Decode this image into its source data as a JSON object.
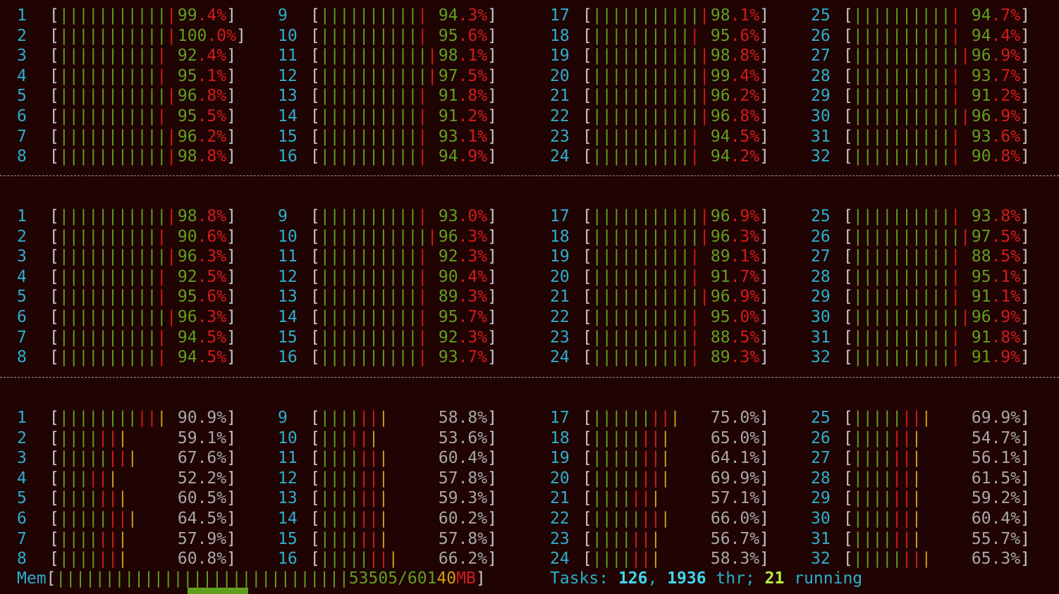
{
  "colors": {
    "background": "#200303",
    "low": "#5fa01e",
    "high": "#d21b1b",
    "mid": "#c9a116",
    "label": "#2bb0cc"
  },
  "blocks": [
    {
      "cpus": [
        {
          "n": "1",
          "v": "99.4%"
        },
        {
          "n": "2",
          "v": "100.0%"
        },
        {
          "n": "3",
          "v": "92.4%"
        },
        {
          "n": "4",
          "v": "95.1%"
        },
        {
          "n": "5",
          "v": "96.8%"
        },
        {
          "n": "6",
          "v": "95.5%"
        },
        {
          "n": "7",
          "v": "96.2%"
        },
        {
          "n": "8",
          "v": "98.8%"
        },
        {
          "n": "9",
          "v": "94.3%"
        },
        {
          "n": "10",
          "v": "95.6%"
        },
        {
          "n": "11",
          "v": "98.1%"
        },
        {
          "n": "12",
          "v": "97.5%"
        },
        {
          "n": "13",
          "v": "91.8%"
        },
        {
          "n": "14",
          "v": "91.2%"
        },
        {
          "n": "15",
          "v": "93.1%"
        },
        {
          "n": "16",
          "v": "94.9%"
        },
        {
          "n": "17",
          "v": "98.1%"
        },
        {
          "n": "18",
          "v": "95.6%"
        },
        {
          "n": "19",
          "v": "98.8%"
        },
        {
          "n": "20",
          "v": "99.4%"
        },
        {
          "n": "21",
          "v": "96.2%"
        },
        {
          "n": "22",
          "v": "96.8%"
        },
        {
          "n": "23",
          "v": "94.5%"
        },
        {
          "n": "24",
          "v": "94.2%"
        },
        {
          "n": "25",
          "v": "94.7%"
        },
        {
          "n": "26",
          "v": "94.4%"
        },
        {
          "n": "27",
          "v": "96.9%"
        },
        {
          "n": "28",
          "v": "93.7%"
        },
        {
          "n": "29",
          "v": "91.2%"
        },
        {
          "n": "30",
          "v": "96.9%"
        },
        {
          "n": "31",
          "v": "93.6%"
        },
        {
          "n": "32",
          "v": "90.8%"
        }
      ]
    },
    {
      "cpus": [
        {
          "n": "1",
          "v": "98.8%"
        },
        {
          "n": "2",
          "v": "90.6%"
        },
        {
          "n": "3",
          "v": "96.3%"
        },
        {
          "n": "4",
          "v": "92.5%"
        },
        {
          "n": "5",
          "v": "95.6%"
        },
        {
          "n": "6",
          "v": "96.3%"
        },
        {
          "n": "7",
          "v": "94.5%"
        },
        {
          "n": "8",
          "v": "94.5%"
        },
        {
          "n": "9",
          "v": "93.0%"
        },
        {
          "n": "10",
          "v": "96.3%"
        },
        {
          "n": "11",
          "v": "92.3%"
        },
        {
          "n": "12",
          "v": "90.4%"
        },
        {
          "n": "13",
          "v": "89.3%"
        },
        {
          "n": "14",
          "v": "95.7%"
        },
        {
          "n": "15",
          "v": "92.3%"
        },
        {
          "n": "16",
          "v": "93.7%"
        },
        {
          "n": "17",
          "v": "96.9%"
        },
        {
          "n": "18",
          "v": "96.3%"
        },
        {
          "n": "19",
          "v": "89.1%"
        },
        {
          "n": "20",
          "v": "91.7%"
        },
        {
          "n": "21",
          "v": "96.9%"
        },
        {
          "n": "22",
          "v": "95.0%"
        },
        {
          "n": "23",
          "v": "88.5%"
        },
        {
          "n": "24",
          "v": "89.3%"
        },
        {
          "n": "25",
          "v": "93.8%"
        },
        {
          "n": "26",
          "v": "97.5%"
        },
        {
          "n": "27",
          "v": "88.5%"
        },
        {
          "n": "28",
          "v": "95.1%"
        },
        {
          "n": "29",
          "v": "91.1%"
        },
        {
          "n": "30",
          "v": "96.9%"
        },
        {
          "n": "31",
          "v": "91.8%"
        },
        {
          "n": "32",
          "v": "91.9%"
        }
      ]
    },
    {
      "cpus": [
        {
          "n": "1",
          "v": "90.9%"
        },
        {
          "n": "2",
          "v": "59.1%"
        },
        {
          "n": "3",
          "v": "67.6%"
        },
        {
          "n": "4",
          "v": "52.2%"
        },
        {
          "n": "5",
          "v": "60.5%"
        },
        {
          "n": "6",
          "v": "64.5%"
        },
        {
          "n": "7",
          "v": "57.9%"
        },
        {
          "n": "8",
          "v": "60.8%"
        },
        {
          "n": "9",
          "v": "58.8%"
        },
        {
          "n": "10",
          "v": "53.6%"
        },
        {
          "n": "11",
          "v": "60.4%"
        },
        {
          "n": "12",
          "v": "57.8%"
        },
        {
          "n": "13",
          "v": "59.3%"
        },
        {
          "n": "14",
          "v": "60.2%"
        },
        {
          "n": "15",
          "v": "57.8%"
        },
        {
          "n": "16",
          "v": "66.2%"
        },
        {
          "n": "17",
          "v": "75.0%"
        },
        {
          "n": "18",
          "v": "65.0%"
        },
        {
          "n": "19",
          "v": "64.1%"
        },
        {
          "n": "20",
          "v": "69.9%"
        },
        {
          "n": "21",
          "v": "57.1%"
        },
        {
          "n": "22",
          "v": "66.0%"
        },
        {
          "n": "23",
          "v": "56.7%"
        },
        {
          "n": "24",
          "v": "58.3%"
        },
        {
          "n": "25",
          "v": "69.9%"
        },
        {
          "n": "26",
          "v": "54.7%"
        },
        {
          "n": "27",
          "v": "56.1%"
        },
        {
          "n": "28",
          "v": "61.5%"
        },
        {
          "n": "29",
          "v": "59.2%"
        },
        {
          "n": "30",
          "v": "60.4%"
        },
        {
          "n": "31",
          "v": "55.7%"
        },
        {
          "n": "32",
          "v": "65.3%"
        }
      ]
    }
  ],
  "memory": {
    "label": "Mem",
    "value": "53505/60140MB"
  },
  "tasks": {
    "label": "Tasks: ",
    "count": "126",
    "sep": ", ",
    "threads": "1936",
    "thr_label": " thr; ",
    "running": "21",
    "running_label": " running"
  }
}
